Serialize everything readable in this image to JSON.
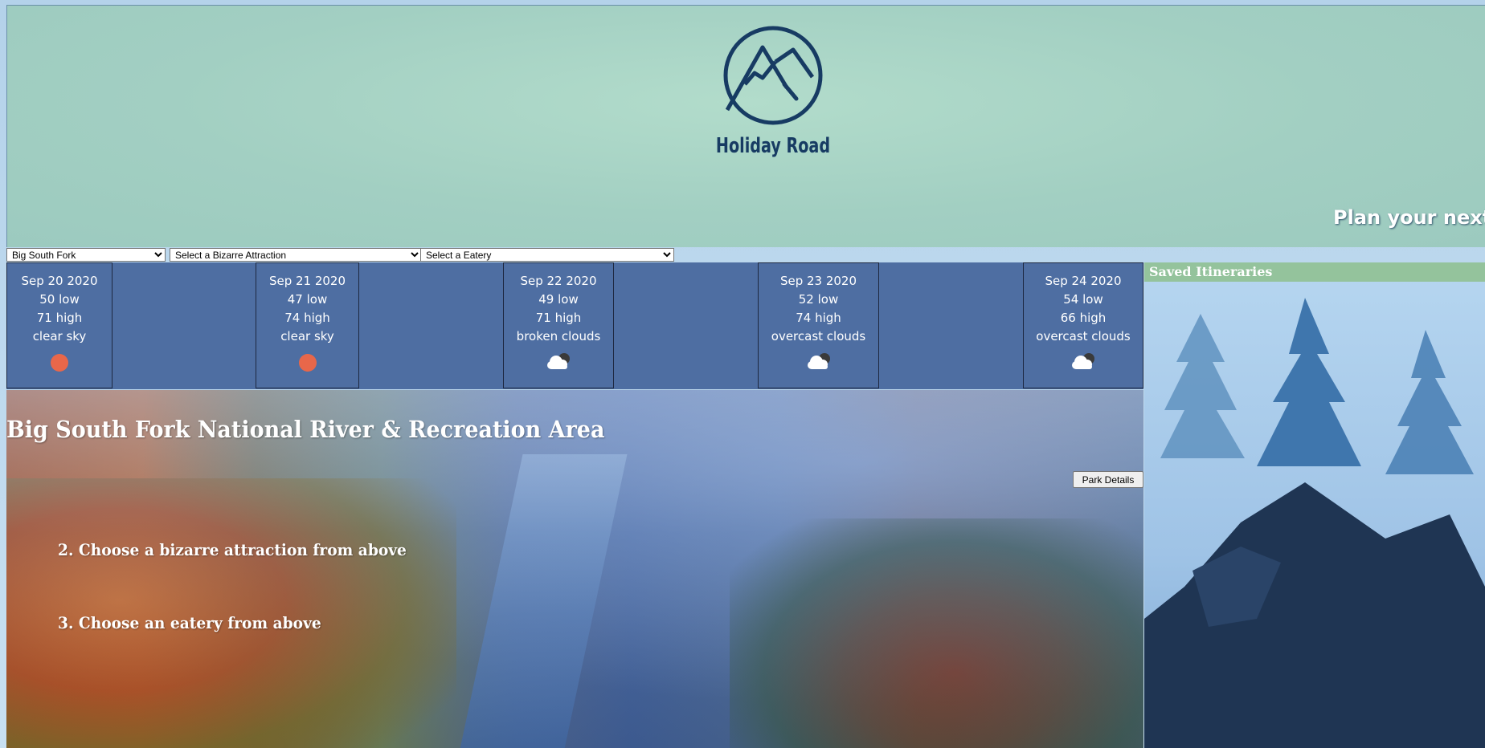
{
  "header": {
    "brand": "Holiday Road",
    "tagline": "Plan your next tr",
    "logo_icon": "mountain-circle-logo",
    "colors": {
      "logo": "#173b63",
      "background": "#a4d2c4"
    }
  },
  "filters": {
    "park": {
      "selected": "Big South Fork"
    },
    "attraction": {
      "selected": "Select a Bizarre Attraction"
    },
    "eatery": {
      "selected": "Select a Eatery"
    }
  },
  "forecast": [
    {
      "date": "Sep 20 2020",
      "low": "50 low",
      "high": "71 high",
      "description": "clear sky",
      "icon": "sun-icon"
    },
    {
      "date": "Sep 21 2020",
      "low": "47 low",
      "high": "74 high",
      "description": "clear sky",
      "icon": "sun-icon"
    },
    {
      "date": "Sep 22 2020",
      "low": "49 low",
      "high": "71 high",
      "description": "broken clouds",
      "icon": "cloud-icon"
    },
    {
      "date": "Sep 23 2020",
      "low": "52 low",
      "high": "74 high",
      "description": "overcast clouds",
      "icon": "cloud-icon"
    },
    {
      "date": "Sep 24 2020",
      "low": "54 low",
      "high": "66 high",
      "description": "overcast clouds",
      "icon": "cloud-icon"
    }
  ],
  "park": {
    "title": "Big South Fork National River & Recreation Area",
    "details_button": "Park Details"
  },
  "steps": [
    "2. Choose a bizarre attraction from above",
    "3. Choose an eatery from above"
  ],
  "saved": {
    "title": "Saved Itineraries"
  }
}
